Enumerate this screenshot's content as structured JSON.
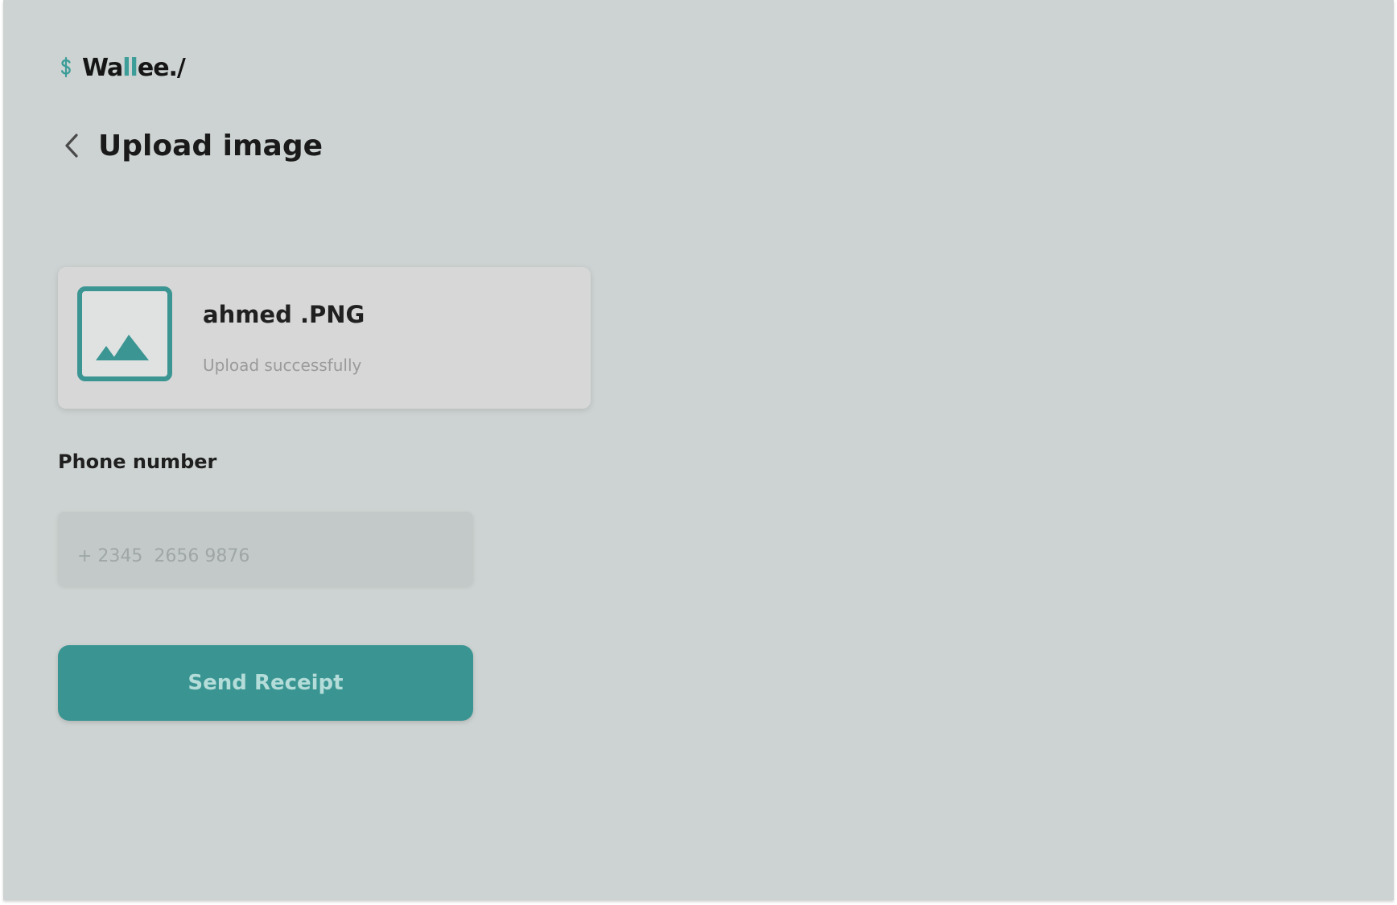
{
  "app": {
    "logo_prefix": "Wa",
    "logo_accent": "ll",
    "logo_suffix": "ee./",
    "accent_color": "#3d9d99",
    "logo_icon": "dollar-icon"
  },
  "header": {
    "title": "Upload image",
    "back_icon": "chevron-left-icon"
  },
  "upload": {
    "file_name": "ahmed .PNG",
    "status": "Upload successfully",
    "thumbnail_icon": "image-icon"
  },
  "form": {
    "phone_label": "Phone number",
    "phone_placeholder": "+ 2345  2656 9876",
    "phone_value": ""
  },
  "actions": {
    "send_label": "Send Receipt",
    "button_color": "#3a9592"
  }
}
